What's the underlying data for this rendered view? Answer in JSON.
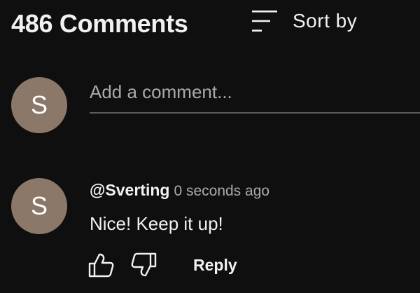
{
  "header": {
    "count_title": "486 Comments",
    "sort_icon": "sort-lines-icon",
    "sort_label": "Sort by"
  },
  "add_comment": {
    "avatar_initial": "S",
    "placeholder": "Add a comment..."
  },
  "comments": [
    {
      "avatar_initial": "S",
      "author": "@Sverting",
      "timestamp": "0 seconds ago",
      "text": "Nice! Keep it up!",
      "like_icon": "thumbs-up-icon",
      "dislike_icon": "thumbs-down-icon",
      "reply_label": "Reply"
    }
  ],
  "colors": {
    "background": "#0f0f0f",
    "avatar": "#8b7869",
    "text_primary": "#f1f1f1",
    "text_secondary": "#aaaaaa"
  }
}
